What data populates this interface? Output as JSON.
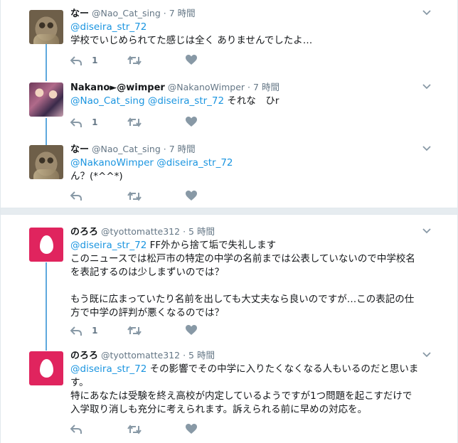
{
  "tweets": [
    {
      "name": "なー",
      "handle": "@Nao_Cat_sing",
      "sep": "·",
      "time": "7 時間",
      "avatar_icon": "cat-photo-avatar",
      "mentions": "@diseira_str_72",
      "text": "学校でいじめられてた感じは全く ありませんでしたよ…",
      "reply_count": "1"
    },
    {
      "name": "Nakano►@wimper",
      "handle": "@NakanoWimper",
      "sep": "·",
      "time": "7 時間",
      "avatar_icon": "people-photo-avatar",
      "mentions": "@Nao_Cat_sing @diseira_str_72",
      "text": " それな　ひr",
      "reply_count": "1"
    },
    {
      "name": "なー",
      "handle": "@Nao_Cat_sing",
      "sep": "·",
      "time": "7 時間",
      "avatar_icon": "cat-photo-avatar",
      "mentions": "@NakanoWimper @diseira_str_72",
      "text": "ん？(*^^*)",
      "reply_count": ""
    },
    {
      "name": "のろろ",
      "handle": "@tyottomatte312",
      "sep": "·",
      "time": "5 時間",
      "avatar_icon": "egg-avatar",
      "mentions": "@diseira_str_72",
      "text": " FF外から捨て垢で失礼します",
      "text2": "このニュースでは松戸市の特定の中学の名前までは公表していないので中学校名\nを表記するのは少しまずいのでは？\n\nもう既に広まっていたり名前を出しても大丈夫なら良いのですが…この表記の仕\n方で中学の評判が悪くなるのでは？",
      "reply_count": "1"
    },
    {
      "name": "のろろ",
      "handle": "@tyottomatte312",
      "sep": "·",
      "time": "5 時間",
      "avatar_icon": "egg-avatar",
      "mentions": "@diseira_str_72",
      "text": " その影響でその中学に入りたくなくなる人もいるのだと思いま",
      "text2": "す。\n特にあなたは受験を終え高校が内定しているようですが1つ問題を起こすだけで\n入学取り消しも充分に考えられます。訴えられる前に早めの対応を。",
      "reply_count": ""
    }
  ],
  "icons": {
    "reply": "reply-icon",
    "retweet": "retweet-icon",
    "like": "heart-icon",
    "menu": "chevron-down-icon"
  },
  "colors": {
    "link": "#1b95e0",
    "thread": "#5ea9dd",
    "egg_bg": "#e0245e",
    "muted": "#8899a6"
  }
}
